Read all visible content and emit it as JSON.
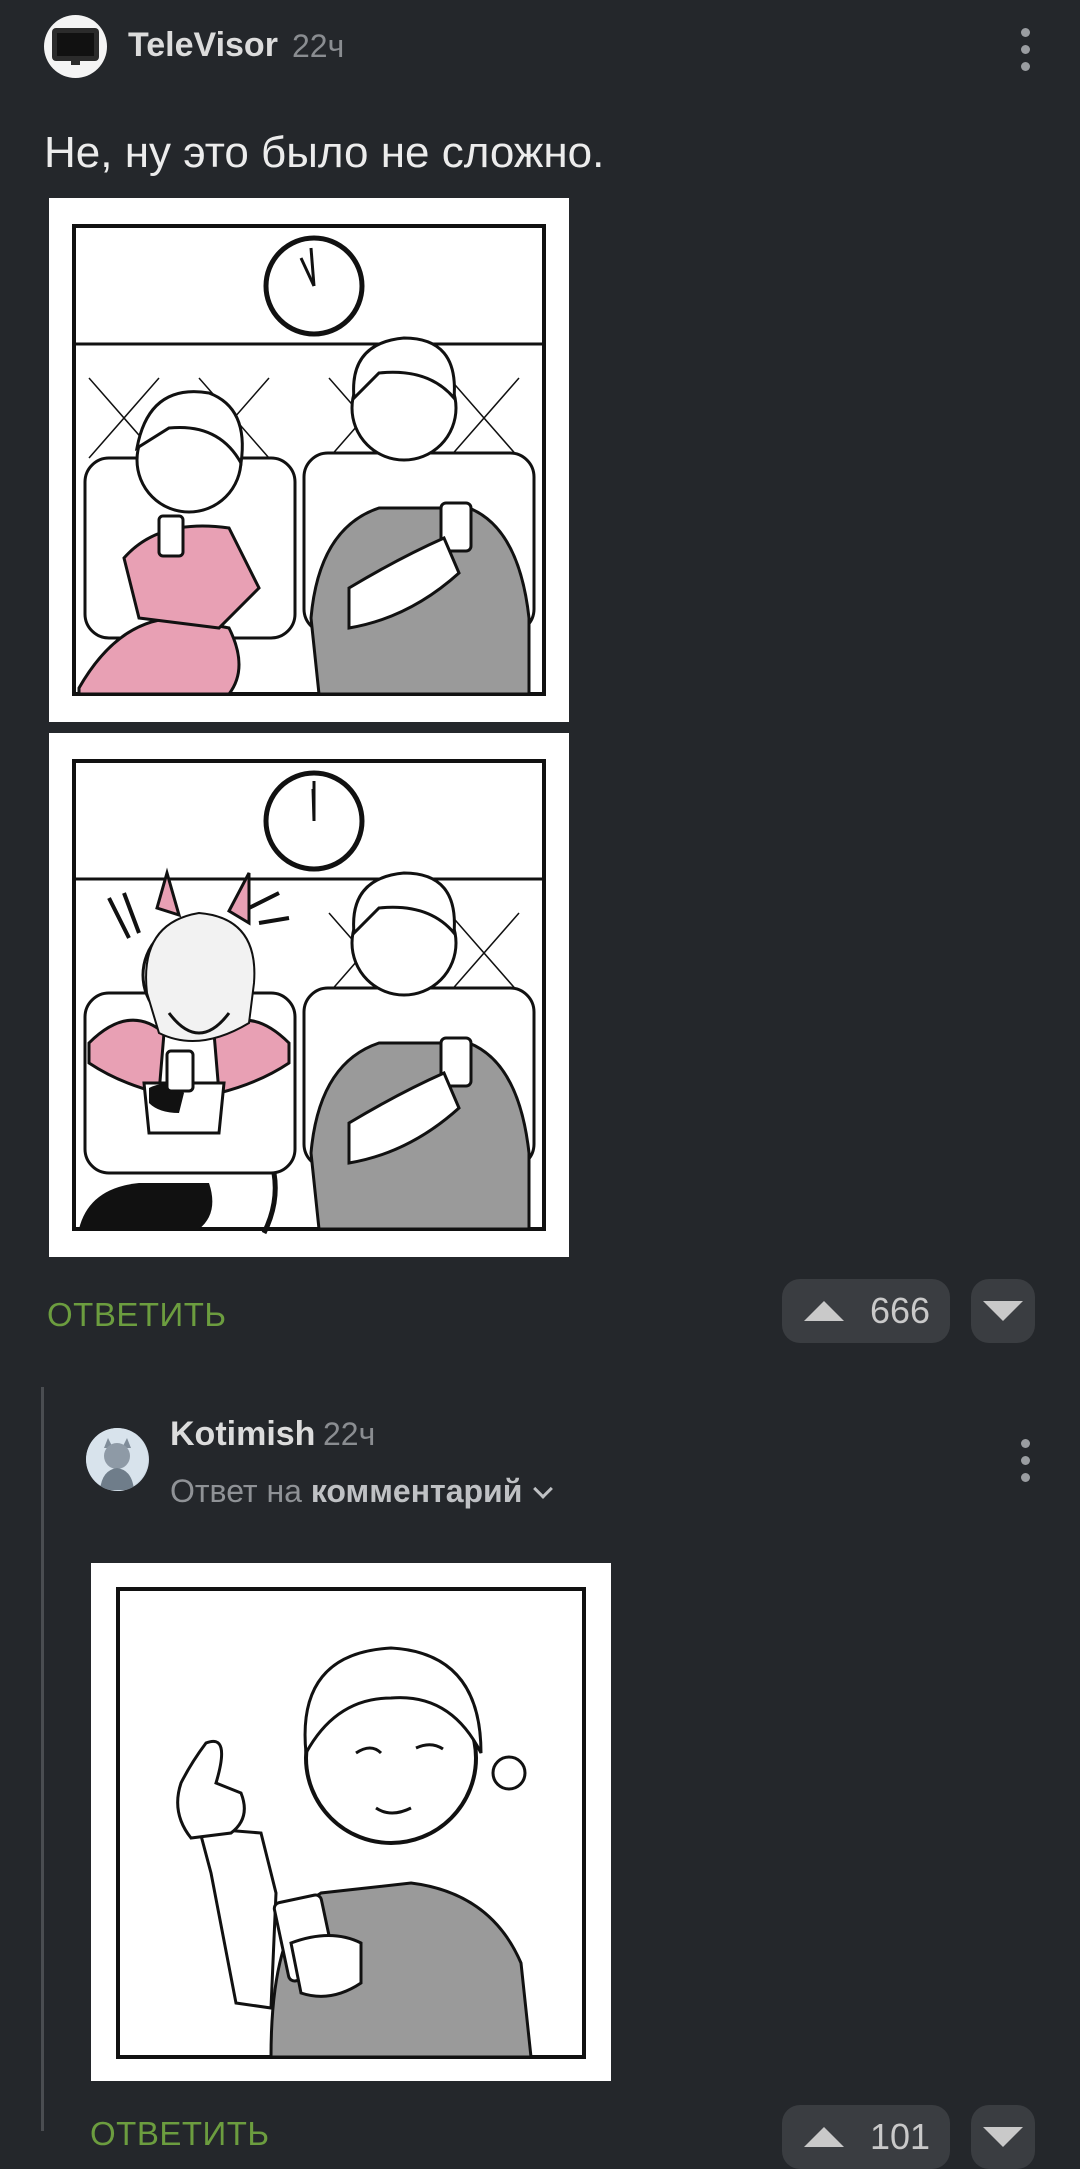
{
  "comment": {
    "author": "TeleVisor",
    "time": "22ч",
    "text": "Не, ну это было не сложно.",
    "reply_label": "ОТВЕТИТЬ",
    "upvotes": "666"
  },
  "reply": {
    "author": "Kotimish",
    "time": "22ч",
    "reply_prefix": "Ответ на",
    "reply_target": "комментарий",
    "reply_label": "ОТВЕТИТЬ",
    "upvotes": "101"
  },
  "colors": {
    "background": "#24272b",
    "accent_green": "#6c9d3f",
    "pink": "#e8a0b4",
    "gray_shirt": "#9a9a9a"
  }
}
